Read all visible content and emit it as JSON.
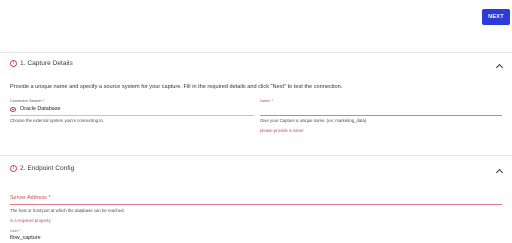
{
  "toolbar": {
    "next_label": "NEXT"
  },
  "capture_details": {
    "title": "1. Capture Details",
    "description": "Provide a unique name and specify a source system for your capture. Fill in the required details and click \"Next\" to test the connection.",
    "connector": {
      "label": "Connector Search *",
      "value": "Oracle Database",
      "helper": "Choose the external system you're connecting to."
    },
    "name": {
      "label": "Name *",
      "value": "",
      "helper": "Give your Capture a unique name. (ex: marketing_data)",
      "error": "please provide a name"
    }
  },
  "endpoint_config": {
    "title": "2. Endpoint Config",
    "server_address": {
      "label": "Server Address *",
      "value": "",
      "helper": "The host or host:port at which the database can be reached.",
      "error": "is a required property"
    },
    "user": {
      "label": "User *",
      "value": "flow_capture"
    }
  },
  "icons": {
    "error": "error-circle-icon",
    "collapse": "chevron-up-icon",
    "database": "oracle-database-icon"
  },
  "colors": {
    "primary": "#2c3cd6",
    "error": "#d94a56"
  }
}
